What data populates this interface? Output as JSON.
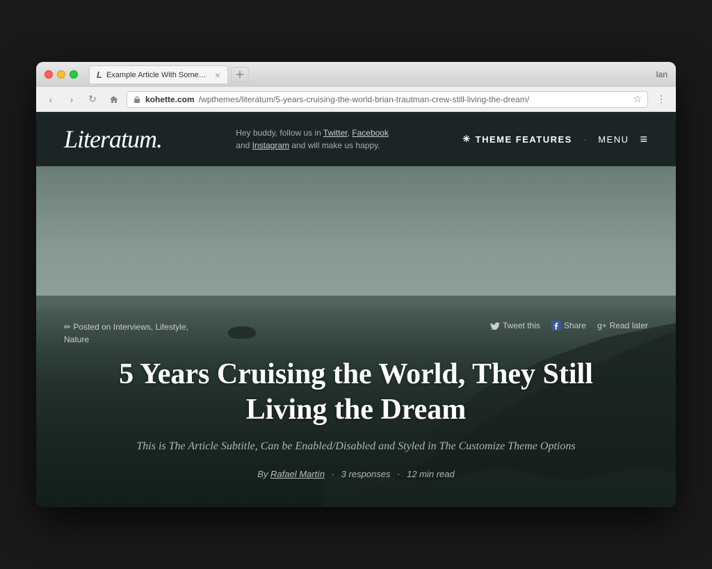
{
  "window": {
    "user": "Ian",
    "traffic_lights": [
      "close",
      "minimize",
      "maximize"
    ]
  },
  "tab": {
    "favicon": "L",
    "title": "Example Article With Some Ac",
    "close_label": "×"
  },
  "addressbar": {
    "back": "‹",
    "forward": "›",
    "refresh": "↻",
    "home": "⌂",
    "url_lock": "🔒",
    "url_full": "kohette.com/wpthemes/literatum/5-years-cruising-the-world-brian-trautman-crew-still-living-the-dream/",
    "url_domain": "kohette.com",
    "url_path": "/wpthemes/literatum/5-years-cruising-the-world-brian-trautman-crew-still-living-the-dream/",
    "star": "☆",
    "menu": "⋮"
  },
  "header": {
    "logo": "Literatum.",
    "tagline_prefix": "Hey buddy, follow us in ",
    "tagline_links": [
      "Twitter",
      "Facebook"
    ],
    "tagline_suffix": "and ",
    "tagline_link2": "Instagram",
    "tagline_end": " and will make us happy.",
    "nav": {
      "asterisk": "✳",
      "theme_features": "THEME FEATURES",
      "dot": "·",
      "menu": "MENU",
      "hamburger": "≡"
    }
  },
  "article": {
    "categories_icon": "✏",
    "categories": "Posted on Interviews, Lifestyle,\nNature",
    "actions": [
      {
        "icon": "🐦",
        "label": "Tweet this"
      },
      {
        "icon": "f",
        "label": "Share"
      },
      {
        "icon": "g+",
        "label": "Read later"
      }
    ],
    "title": "5 Years Cruising the World, They Still Living the Dream",
    "subtitle": "This is The Article Subtitle, Can be Enabled/Disabled and Styled in The Customize Theme Options",
    "byline_prefix": "By ",
    "author": "Rafael Martín",
    "responses": "3 responses",
    "read_time": "12 min read",
    "sep": "·"
  }
}
